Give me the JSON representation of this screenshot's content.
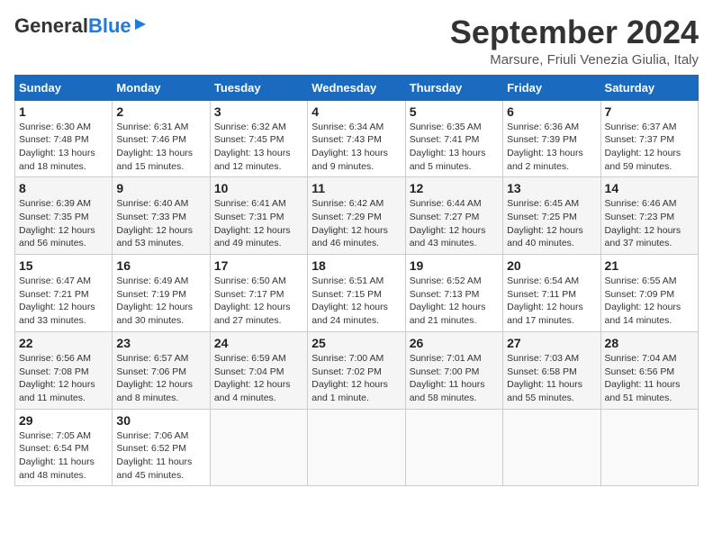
{
  "header": {
    "logo_general": "General",
    "logo_blue": "Blue",
    "month_title": "September 2024",
    "location": "Marsure, Friuli Venezia Giulia, Italy"
  },
  "columns": [
    "Sunday",
    "Monday",
    "Tuesday",
    "Wednesday",
    "Thursday",
    "Friday",
    "Saturday"
  ],
  "weeks": [
    [
      {
        "day": "1",
        "sunrise": "Sunrise: 6:30 AM",
        "sunset": "Sunset: 7:48 PM",
        "daylight": "Daylight: 13 hours and 18 minutes."
      },
      {
        "day": "2",
        "sunrise": "Sunrise: 6:31 AM",
        "sunset": "Sunset: 7:46 PM",
        "daylight": "Daylight: 13 hours and 15 minutes."
      },
      {
        "day": "3",
        "sunrise": "Sunrise: 6:32 AM",
        "sunset": "Sunset: 7:45 PM",
        "daylight": "Daylight: 13 hours and 12 minutes."
      },
      {
        "day": "4",
        "sunrise": "Sunrise: 6:34 AM",
        "sunset": "Sunset: 7:43 PM",
        "daylight": "Daylight: 13 hours and 9 minutes."
      },
      {
        "day": "5",
        "sunrise": "Sunrise: 6:35 AM",
        "sunset": "Sunset: 7:41 PM",
        "daylight": "Daylight: 13 hours and 5 minutes."
      },
      {
        "day": "6",
        "sunrise": "Sunrise: 6:36 AM",
        "sunset": "Sunset: 7:39 PM",
        "daylight": "Daylight: 13 hours and 2 minutes."
      },
      {
        "day": "7",
        "sunrise": "Sunrise: 6:37 AM",
        "sunset": "Sunset: 7:37 PM",
        "daylight": "Daylight: 12 hours and 59 minutes."
      }
    ],
    [
      {
        "day": "8",
        "sunrise": "Sunrise: 6:39 AM",
        "sunset": "Sunset: 7:35 PM",
        "daylight": "Daylight: 12 hours and 56 minutes."
      },
      {
        "day": "9",
        "sunrise": "Sunrise: 6:40 AM",
        "sunset": "Sunset: 7:33 PM",
        "daylight": "Daylight: 12 hours and 53 minutes."
      },
      {
        "day": "10",
        "sunrise": "Sunrise: 6:41 AM",
        "sunset": "Sunset: 7:31 PM",
        "daylight": "Daylight: 12 hours and 49 minutes."
      },
      {
        "day": "11",
        "sunrise": "Sunrise: 6:42 AM",
        "sunset": "Sunset: 7:29 PM",
        "daylight": "Daylight: 12 hours and 46 minutes."
      },
      {
        "day": "12",
        "sunrise": "Sunrise: 6:44 AM",
        "sunset": "Sunset: 7:27 PM",
        "daylight": "Daylight: 12 hours and 43 minutes."
      },
      {
        "day": "13",
        "sunrise": "Sunrise: 6:45 AM",
        "sunset": "Sunset: 7:25 PM",
        "daylight": "Daylight: 12 hours and 40 minutes."
      },
      {
        "day": "14",
        "sunrise": "Sunrise: 6:46 AM",
        "sunset": "Sunset: 7:23 PM",
        "daylight": "Daylight: 12 hours and 37 minutes."
      }
    ],
    [
      {
        "day": "15",
        "sunrise": "Sunrise: 6:47 AM",
        "sunset": "Sunset: 7:21 PM",
        "daylight": "Daylight: 12 hours and 33 minutes."
      },
      {
        "day": "16",
        "sunrise": "Sunrise: 6:49 AM",
        "sunset": "Sunset: 7:19 PM",
        "daylight": "Daylight: 12 hours and 30 minutes."
      },
      {
        "day": "17",
        "sunrise": "Sunrise: 6:50 AM",
        "sunset": "Sunset: 7:17 PM",
        "daylight": "Daylight: 12 hours and 27 minutes."
      },
      {
        "day": "18",
        "sunrise": "Sunrise: 6:51 AM",
        "sunset": "Sunset: 7:15 PM",
        "daylight": "Daylight: 12 hours and 24 minutes."
      },
      {
        "day": "19",
        "sunrise": "Sunrise: 6:52 AM",
        "sunset": "Sunset: 7:13 PM",
        "daylight": "Daylight: 12 hours and 21 minutes."
      },
      {
        "day": "20",
        "sunrise": "Sunrise: 6:54 AM",
        "sunset": "Sunset: 7:11 PM",
        "daylight": "Daylight: 12 hours and 17 minutes."
      },
      {
        "day": "21",
        "sunrise": "Sunrise: 6:55 AM",
        "sunset": "Sunset: 7:09 PM",
        "daylight": "Daylight: 12 hours and 14 minutes."
      }
    ],
    [
      {
        "day": "22",
        "sunrise": "Sunrise: 6:56 AM",
        "sunset": "Sunset: 7:08 PM",
        "daylight": "Daylight: 12 hours and 11 minutes."
      },
      {
        "day": "23",
        "sunrise": "Sunrise: 6:57 AM",
        "sunset": "Sunset: 7:06 PM",
        "daylight": "Daylight: 12 hours and 8 minutes."
      },
      {
        "day": "24",
        "sunrise": "Sunrise: 6:59 AM",
        "sunset": "Sunset: 7:04 PM",
        "daylight": "Daylight: 12 hours and 4 minutes."
      },
      {
        "day": "25",
        "sunrise": "Sunrise: 7:00 AM",
        "sunset": "Sunset: 7:02 PM",
        "daylight": "Daylight: 12 hours and 1 minute."
      },
      {
        "day": "26",
        "sunrise": "Sunrise: 7:01 AM",
        "sunset": "Sunset: 7:00 PM",
        "daylight": "Daylight: 11 hours and 58 minutes."
      },
      {
        "day": "27",
        "sunrise": "Sunrise: 7:03 AM",
        "sunset": "Sunset: 6:58 PM",
        "daylight": "Daylight: 11 hours and 55 minutes."
      },
      {
        "day": "28",
        "sunrise": "Sunrise: 7:04 AM",
        "sunset": "Sunset: 6:56 PM",
        "daylight": "Daylight: 11 hours and 51 minutes."
      }
    ],
    [
      {
        "day": "29",
        "sunrise": "Sunrise: 7:05 AM",
        "sunset": "Sunset: 6:54 PM",
        "daylight": "Daylight: 11 hours and 48 minutes."
      },
      {
        "day": "30",
        "sunrise": "Sunrise: 7:06 AM",
        "sunset": "Sunset: 6:52 PM",
        "daylight": "Daylight: 11 hours and 45 minutes."
      },
      {
        "day": "",
        "sunrise": "",
        "sunset": "",
        "daylight": ""
      },
      {
        "day": "",
        "sunrise": "",
        "sunset": "",
        "daylight": ""
      },
      {
        "day": "",
        "sunrise": "",
        "sunset": "",
        "daylight": ""
      },
      {
        "day": "",
        "sunrise": "",
        "sunset": "",
        "daylight": ""
      },
      {
        "day": "",
        "sunrise": "",
        "sunset": "",
        "daylight": ""
      }
    ]
  ]
}
